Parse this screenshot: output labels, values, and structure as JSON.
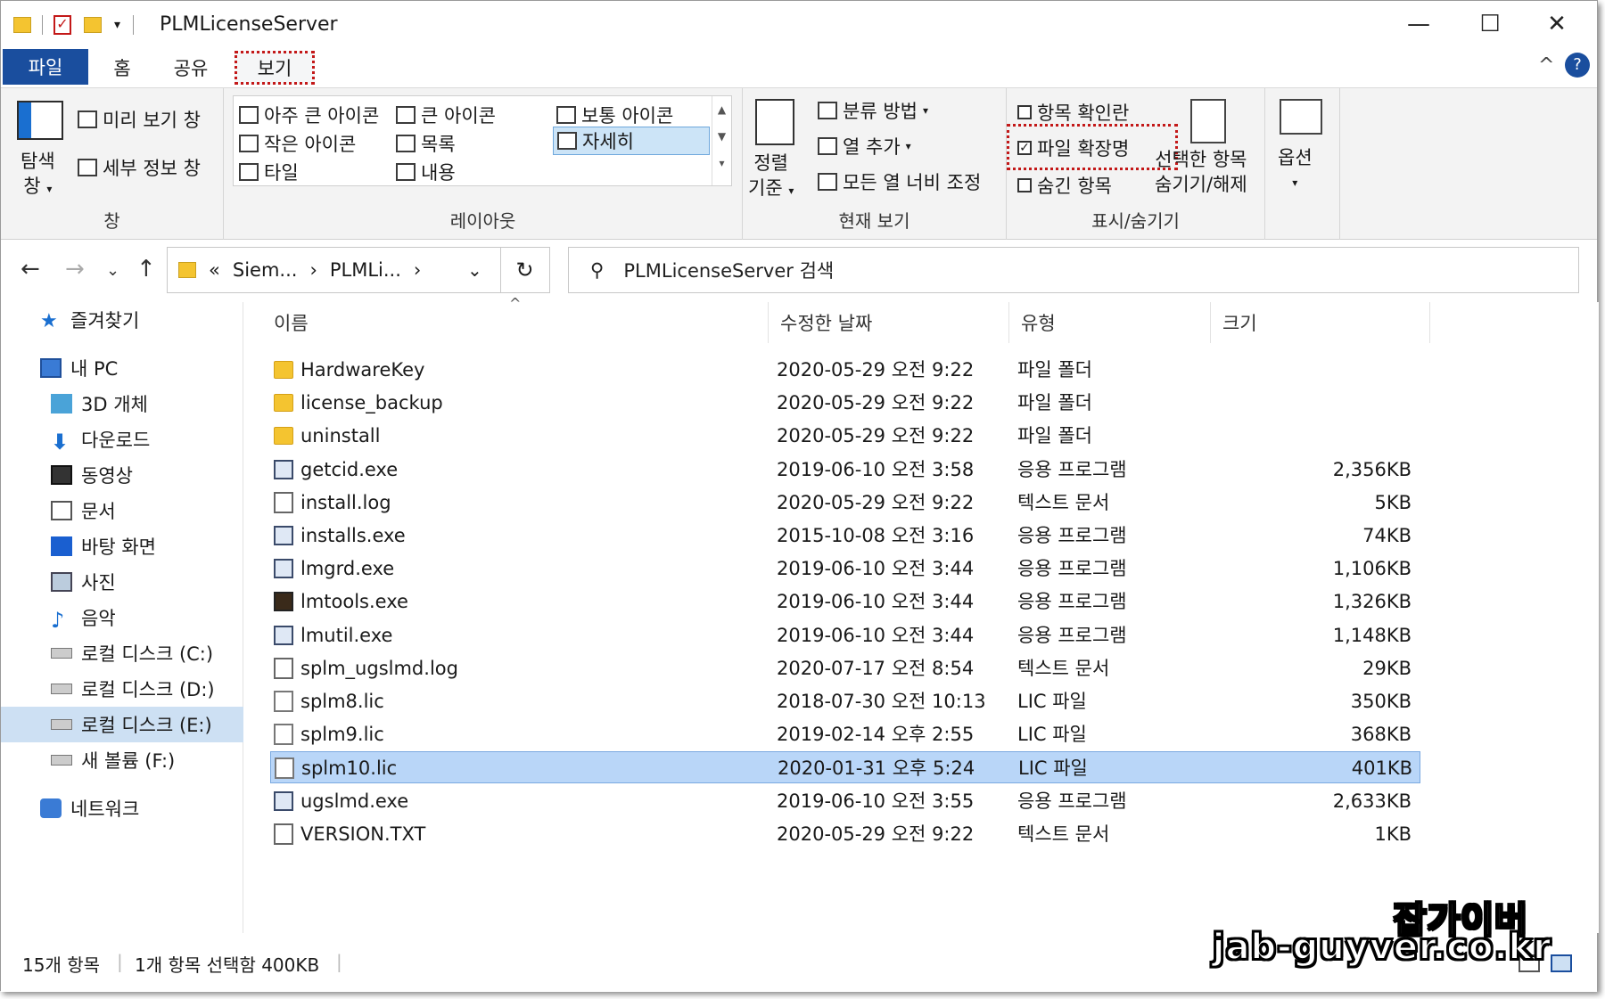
{
  "window": {
    "title": "PLMLicenseServer"
  },
  "controls": {
    "minimize": "—",
    "maximize": "☐",
    "close": "✕"
  },
  "ribbon_tabs": [
    "파일",
    "홈",
    "공유",
    "보기"
  ],
  "ribbon_aux": {
    "collapse": "^",
    "help": "?"
  },
  "ribbon": {
    "pane_group": {
      "nav_pane_line1": "탐색",
      "nav_pane_line2": "창",
      "preview": "미리 보기 창",
      "details": "세부 정보 창",
      "label": "창"
    },
    "layout_group": {
      "items": [
        "아주 큰 아이콘",
        "큰 아이콘",
        "보통 아이콘",
        "작은 아이콘",
        "목록",
        "자세히",
        "타일",
        "내용"
      ],
      "label": "레이아웃"
    },
    "view_group": {
      "sort_line1": "정렬",
      "sort_line2": "기준",
      "group_by": "분류 방법",
      "add_column": "열 추가",
      "fit_columns": "모든 열 너비 조정",
      "label": "현재 보기"
    },
    "showhide_group": {
      "item_checkbox": "항목 확인란",
      "file_ext": "파일 확장명",
      "hidden_items": "숨긴 항목",
      "hide_selected_line1": "선택한 항목",
      "hide_selected_line2": "숨기기/해제",
      "label": "표시/숨기기"
    },
    "options": "옵션"
  },
  "address": {
    "path": [
      "Siem...",
      "PLMLi..."
    ],
    "prefix": "«",
    "search_placeholder": "PLMLicenseServer 검색"
  },
  "navpane": [
    {
      "label": "즐겨찾기",
      "icon": "star-icon"
    },
    {
      "label": "내 PC",
      "icon": "pc-icon"
    },
    {
      "label": "3D 개체",
      "icon": "cube-icon"
    },
    {
      "label": "다운로드",
      "icon": "download-icon"
    },
    {
      "label": "동영상",
      "icon": "video-icon"
    },
    {
      "label": "문서",
      "icon": "document-icon"
    },
    {
      "label": "바탕 화면",
      "icon": "desktop-icon"
    },
    {
      "label": "사진",
      "icon": "picture-icon"
    },
    {
      "label": "음악",
      "icon": "music-icon"
    },
    {
      "label": "로컬 디스크 (C:)",
      "icon": "disk-icon"
    },
    {
      "label": "로컬 디스크 (D:)",
      "icon": "disk-icon"
    },
    {
      "label": "로컬 디스크 (E:)",
      "icon": "disk-icon"
    },
    {
      "label": "새 볼륨 (F:)",
      "icon": "disk-icon"
    },
    {
      "label": "네트워크",
      "icon": "network-icon"
    }
  ],
  "columns": {
    "name": "이름",
    "date": "수정한 날짜",
    "type": "유형",
    "size": "크기"
  },
  "files": [
    {
      "name": "HardwareKey",
      "date": "2020-05-29 오전 9:22",
      "type": "파일 폴더",
      "size": "",
      "icon": "folder"
    },
    {
      "name": "license_backup",
      "date": "2020-05-29 오전 9:22",
      "type": "파일 폴더",
      "size": "",
      "icon": "folder"
    },
    {
      "name": "uninstall",
      "date": "2020-05-29 오전 9:22",
      "type": "파일 폴더",
      "size": "",
      "icon": "folder"
    },
    {
      "name": "getcid.exe",
      "date": "2019-06-10 오전 3:58",
      "type": "응용 프로그램",
      "size": "2,356KB",
      "icon": "exe"
    },
    {
      "name": "install.log",
      "date": "2020-05-29 오전 9:22",
      "type": "텍스트 문서",
      "size": "5KB",
      "icon": "doc"
    },
    {
      "name": "installs.exe",
      "date": "2015-10-08 오전 3:16",
      "type": "응용 프로그램",
      "size": "74KB",
      "icon": "exe"
    },
    {
      "name": "lmgrd.exe",
      "date": "2019-06-10 오전 3:44",
      "type": "응용 프로그램",
      "size": "1,106KB",
      "icon": "exe"
    },
    {
      "name": "lmtools.exe",
      "date": "2019-06-10 오전 3:44",
      "type": "응용 프로그램",
      "size": "1,326KB",
      "icon": "tools"
    },
    {
      "name": "lmutil.exe",
      "date": "2019-06-10 오전 3:44",
      "type": "응용 프로그램",
      "size": "1,148KB",
      "icon": "exe"
    },
    {
      "name": "splm_ugslmd.log",
      "date": "2020-07-17 오전 8:54",
      "type": "텍스트 문서",
      "size": "29KB",
      "icon": "doc"
    },
    {
      "name": "splm8.lic",
      "date": "2018-07-30 오전 10:13",
      "type": "LIC 파일",
      "size": "350KB",
      "icon": "lic"
    },
    {
      "name": "splm9.lic",
      "date": "2019-02-14 오후 2:55",
      "type": "LIC 파일",
      "size": "368KB",
      "icon": "lic"
    },
    {
      "name": "splm10.lic",
      "date": "2020-01-31 오후 5:24",
      "type": "LIC 파일",
      "size": "401KB",
      "icon": "lic",
      "selected": true
    },
    {
      "name": "ugslmd.exe",
      "date": "2019-06-10 오전 3:55",
      "type": "응용 프로그램",
      "size": "2,633KB",
      "icon": "exe"
    },
    {
      "name": "VERSION.TXT",
      "date": "2020-05-29 오전 9:22",
      "type": "텍스트 문서",
      "size": "1KB",
      "icon": "doc"
    }
  ],
  "status": {
    "count": "15개 항목",
    "selection": "1개 항목 선택함 400KB"
  },
  "watermark": {
    "line1": "잡가이버",
    "line2": "jab-guyver.co.kr"
  },
  "colors": {
    "accent": "#1a4e9e",
    "selection": "#b9d6f8",
    "highlight_border": "#c31818"
  }
}
